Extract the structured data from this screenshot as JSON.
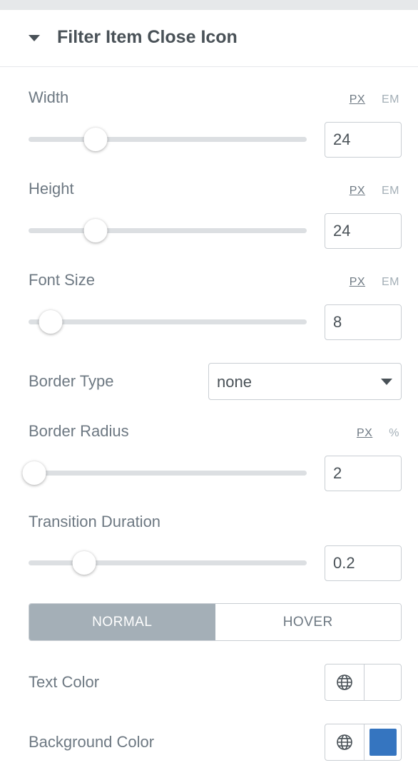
{
  "section": {
    "title": "Filter Item Close Icon"
  },
  "width": {
    "label": "Width",
    "units": [
      "PX",
      "EM"
    ],
    "active_unit": "PX",
    "value": "24",
    "slider_fraction": 0.24
  },
  "height": {
    "label": "Height",
    "units": [
      "PX",
      "EM"
    ],
    "active_unit": "PX",
    "value": "24",
    "slider_fraction": 0.24
  },
  "font_size": {
    "label": "Font Size",
    "units": [
      "PX",
      "EM"
    ],
    "active_unit": "PX",
    "value": "8",
    "slider_fraction": 0.08
  },
  "border_type": {
    "label": "Border Type",
    "value": "none"
  },
  "border_radius": {
    "label": "Border Radius",
    "units": [
      "PX",
      "%"
    ],
    "active_unit": "PX",
    "value": "2",
    "slider_fraction": 0.02
  },
  "transition_duration": {
    "label": "Transition Duration",
    "value": "0.2",
    "slider_fraction": 0.2
  },
  "state_tabs": {
    "normal": "NORMAL",
    "hover": "HOVER",
    "active": "normal"
  },
  "text_color": {
    "label": "Text Color",
    "swatch": "#ffffff"
  },
  "background_color": {
    "label": "Background Color",
    "swatch": "#3575c0"
  },
  "colors": {
    "header_text": "#495157",
    "label_text": "#6d7882",
    "muted": "#a4afb7",
    "track": "#dcdfe2"
  }
}
